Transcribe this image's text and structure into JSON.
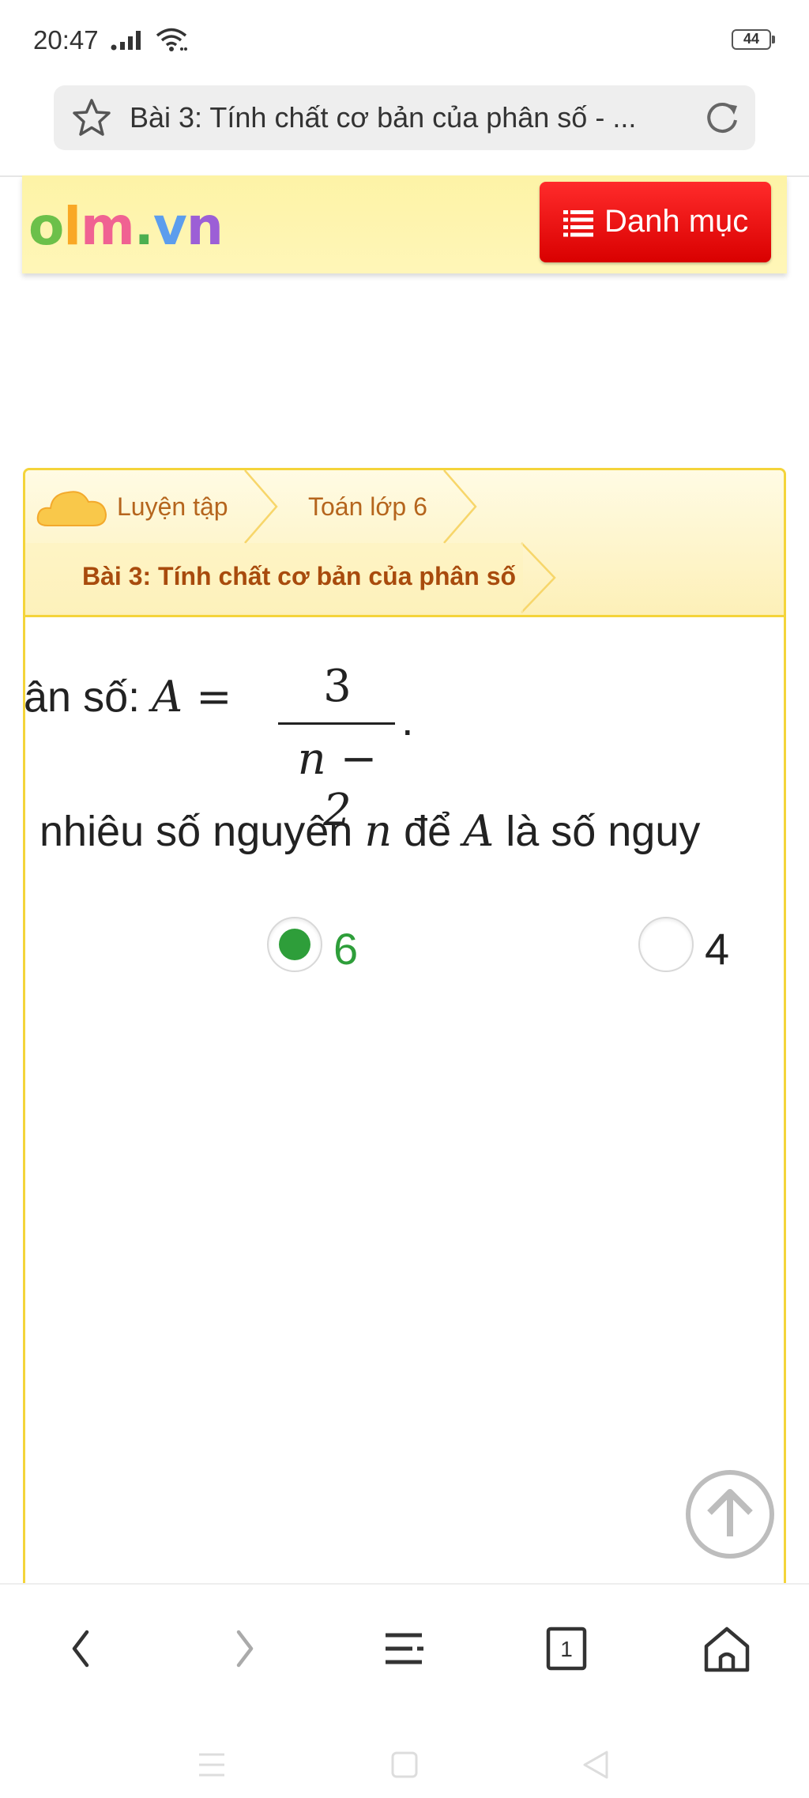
{
  "status_bar": {
    "time": "20:47",
    "battery": "44"
  },
  "browser": {
    "page_title": "Bài 3: Tính chất cơ bản của phân số - ..."
  },
  "site": {
    "logo": "olm.vn",
    "menu_button": "Danh mục",
    "colors": {
      "menu_button": "#e60000",
      "header_bg": "#fdf3a6",
      "panel_border": "#f4d43a"
    }
  },
  "breadcrumb": {
    "items": [
      "Luyện tập",
      "Toán lớp 6",
      "Bài 3: Tính chất cơ bản của phân số"
    ]
  },
  "question": {
    "line1_prefix": "ân số: ",
    "line1_var": "A",
    "line1_eq": " = ",
    "fraction_numerator": "3",
    "fraction_denominator": "n − 2",
    "line1_suffix": ".",
    "line2_part1": "nhiêu số nguyên ",
    "line2_var_n": "n",
    "line2_part2": " để ",
    "line2_var_a": "A",
    "line2_part3": " là số nguy"
  },
  "options": [
    {
      "label": "6",
      "selected": true,
      "color": "#2e9e3a"
    },
    {
      "label": "4",
      "selected": false,
      "color": "#222222"
    }
  ],
  "icons": {
    "status": [
      "signal-icon",
      "wifi-icon",
      "battery-icon"
    ],
    "address_bar": [
      "star-icon",
      "reload-icon"
    ],
    "header": [
      "list-icon"
    ],
    "page": [
      "cloud-icon",
      "scroll-to-top-icon"
    ],
    "browser_nav": [
      "back-icon",
      "forward-icon",
      "menu-icon",
      "tabs-icon",
      "home-icon"
    ],
    "system_nav": [
      "recent-apps-icon",
      "home-square-icon",
      "back-triangle-icon"
    ]
  },
  "browser_nav": {
    "tab_count": "1"
  }
}
